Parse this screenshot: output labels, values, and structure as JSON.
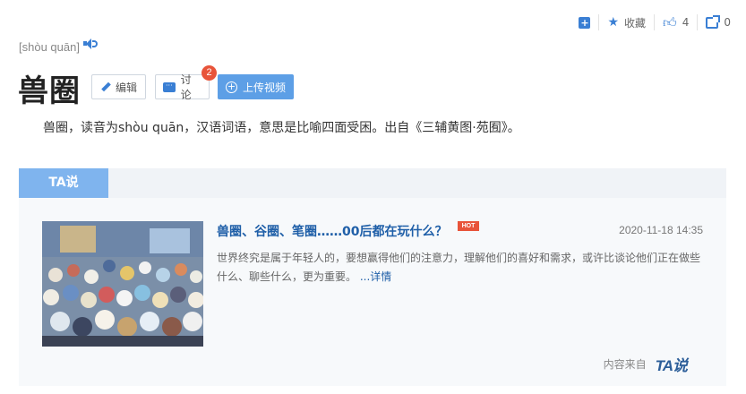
{
  "actions": {
    "add_icon": "square-plus-icon",
    "favorite_label": "收藏",
    "like_count": "4",
    "share_count": "0"
  },
  "entry": {
    "pinyin": "[shòu quān]",
    "title": "兽圈",
    "edit_label": "编辑",
    "discuss_label": "讨论",
    "discuss_badge": "2",
    "upload_label": "上传视频",
    "summary": "兽圈，读音为shòu quān，汉语词语，意思是比喻四面受困。出自《三辅黄图·苑囿》。"
  },
  "ta_section": {
    "tab_label": "TA说",
    "article": {
      "title": "兽圈、谷圈、笔圈……00后都在玩什么？",
      "hot_label": "HOT",
      "date": "2020-11-18 14:35",
      "description": "世界终究是属于年轻人的，要想赢得他们的注意力，理解他们的喜好和需求，或许比谈论他们正在做些什么、聊些什么，更为重要。",
      "more_label": "...详情"
    },
    "source_label": "内容来自",
    "source_logo": "TA说"
  },
  "colors": {
    "accent": "#3a7fd4",
    "link": "#1f5fa8",
    "badge": "#e8543a",
    "tab_active": "#7fb4ee"
  }
}
